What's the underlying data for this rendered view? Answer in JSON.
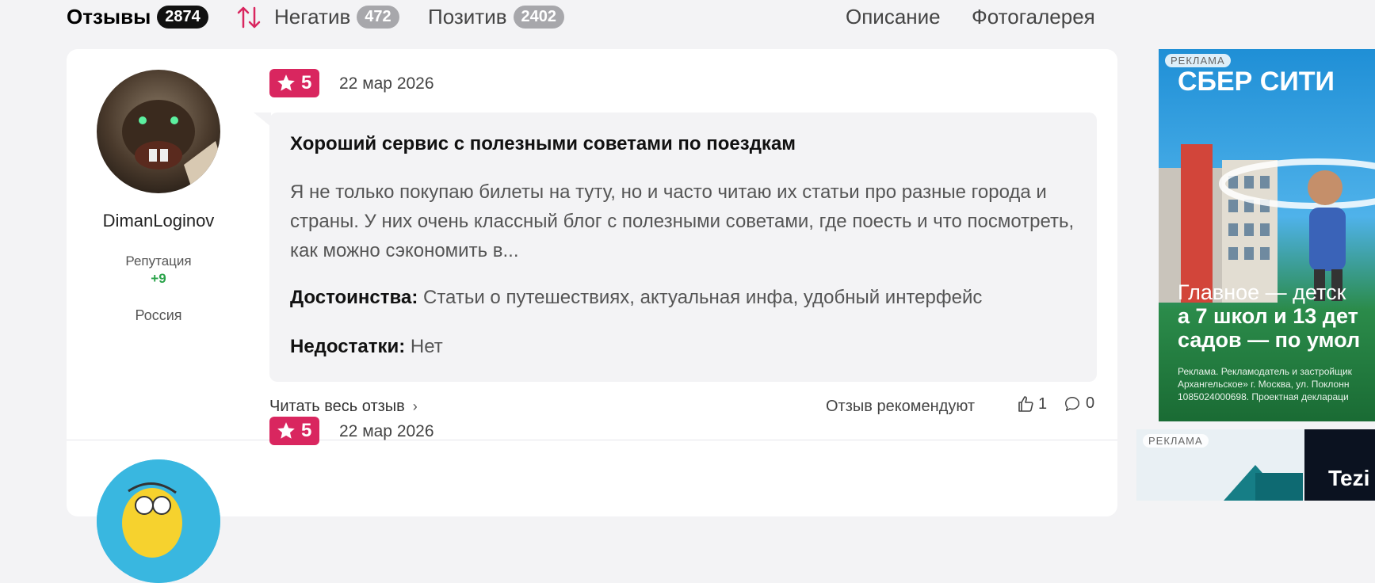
{
  "tabs": {
    "reviews_label": "Отзывы",
    "reviews_count": "2874",
    "negative_label": "Негатив",
    "negative_count": "472",
    "positive_label": "Позитив",
    "positive_count": "2402",
    "description_label": "Описание",
    "gallery_label": "Фотогалерея"
  },
  "reviews": [
    {
      "author": "DimanLoginov",
      "reputation_label": "Репутация",
      "reputation_value": "+9",
      "country": "Россия",
      "rating": "5",
      "date": "22 мар 2026",
      "title": "Хороший сервис с полезными советами по поездкам",
      "text": "Я не только покупаю билеты на туту, но и часто читаю их статьи про разные города и страны. У них очень классный блог с полезными советами, где поесть и что посмотреть, как можно сэкономить в...",
      "pros_label": "Достоинства:",
      "pros": "Статьи о путешествиях, актуальная инфа, удобный интерфейс",
      "cons_label": "Недостатки:",
      "cons": "Нет",
      "read_more": "Читать весь отзыв",
      "recommend_label": "Отзыв рекомендуют",
      "likes": "1",
      "comments": "0"
    },
    {
      "rating": "5",
      "date": "22 мар 2026"
    }
  ],
  "ads": {
    "ad1": {
      "label": "РЕКЛАМА",
      "title": "СБЕР СИТИ",
      "line1": "Главное — детск",
      "line2": "а 7 школ и 13 дет",
      "line3": "садов — по умол",
      "small1": "Реклама. Рекламодатель и застройщик",
      "small2": "Архангельское» г. Москва, ул. Поклонн",
      "small3": "1085024000698. Проектная деклараци"
    },
    "ad2": {
      "label": "РЕКЛАМА",
      "text": "Tezi"
    }
  },
  "colors": {
    "accent": "#d9265f",
    "reputation": "#2aa34a"
  }
}
